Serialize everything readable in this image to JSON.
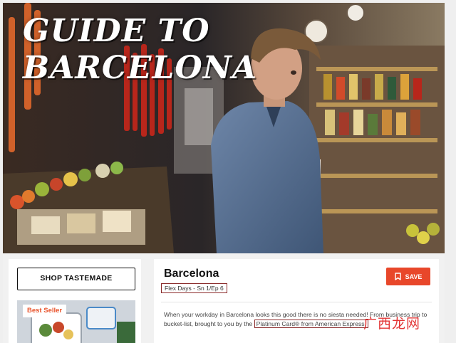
{
  "hero": {
    "title": "GUIDE TO\nBARCELONA"
  },
  "sidebar": {
    "shop_button": "SHOP TASTEMADE",
    "product_badge": "Best Seller"
  },
  "episode": {
    "title": "Barcelona",
    "meta": "Flex Days - Sn 1/Ep 6",
    "save_label": "SAVE",
    "description_part1": "When your workday in Barcelona looks this good there is no siesta needed! From business trip to bucket-list, brought to you by the ",
    "description_sponsor": "Platinum Card® from American Express.",
    "description_part2": ""
  },
  "watermark": {
    "text": "广西龙网"
  },
  "colors": {
    "accent": "#e8472a",
    "annotation_box": "#8a2a2a"
  },
  "icons": {
    "save": "bookmark-icon"
  }
}
